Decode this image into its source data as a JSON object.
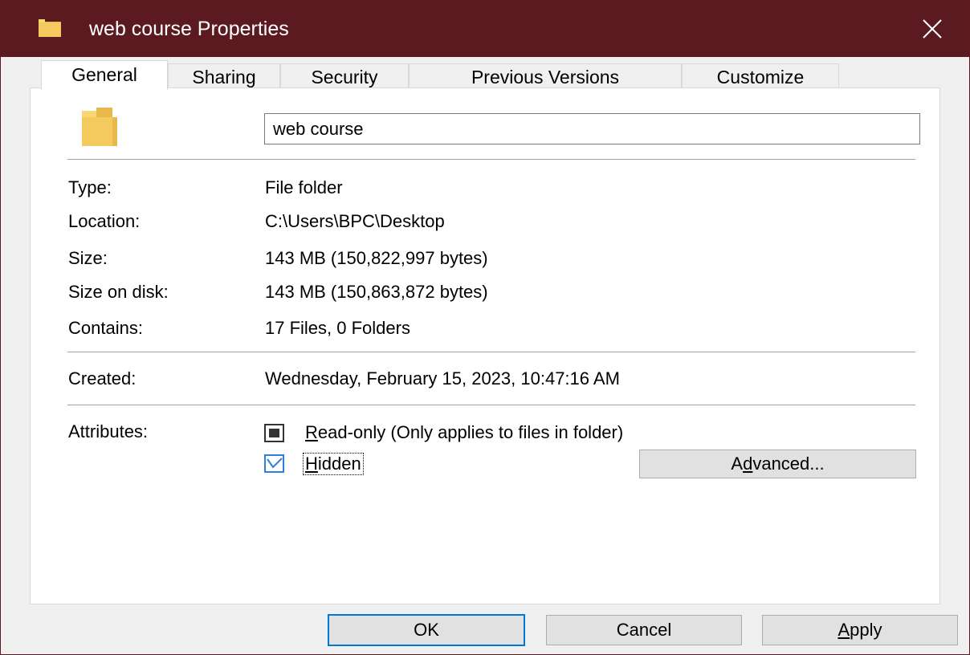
{
  "window": {
    "title": "web course Properties",
    "accent_color": "#5b1a20",
    "icon": "folder-icon",
    "close_icon": "close-icon"
  },
  "tabs": [
    {
      "label": "General",
      "active": true
    },
    {
      "label": "Sharing",
      "active": false
    },
    {
      "label": "Security",
      "active": false
    },
    {
      "label": "Previous Versions",
      "active": false
    },
    {
      "label": "Customize",
      "active": false
    }
  ],
  "general": {
    "folder_name": "web course",
    "properties": [
      {
        "label": "Type:",
        "value": "File folder"
      },
      {
        "label": "Location:",
        "value": "C:\\Users\\BPC\\Desktop"
      },
      {
        "label": "Size:",
        "value": "143 MB (150,822,997 bytes)"
      },
      {
        "label": "Size on disk:",
        "value": "143 MB (150,863,872 bytes)"
      },
      {
        "label": "Contains:",
        "value": "17 Files, 0 Folders"
      }
    ],
    "created": {
      "label": "Created:",
      "value": "Wednesday, February 15, 2023, 10:47:16 AM"
    },
    "attributes": {
      "label": "Attributes:",
      "readonly": {
        "first_letter": "R",
        "rest": "ead-only (Only applies to files in folder)",
        "state": "indeterminate"
      },
      "hidden": {
        "first_letter": "H",
        "rest": "idden",
        "state": "checked"
      },
      "advanced_button": {
        "before": "A",
        "underlined": "d",
        "after": "vanced..."
      }
    }
  },
  "footer": {
    "ok": "OK",
    "cancel": "Cancel",
    "apply": {
      "underlined": "A",
      "rest": "pply"
    }
  }
}
